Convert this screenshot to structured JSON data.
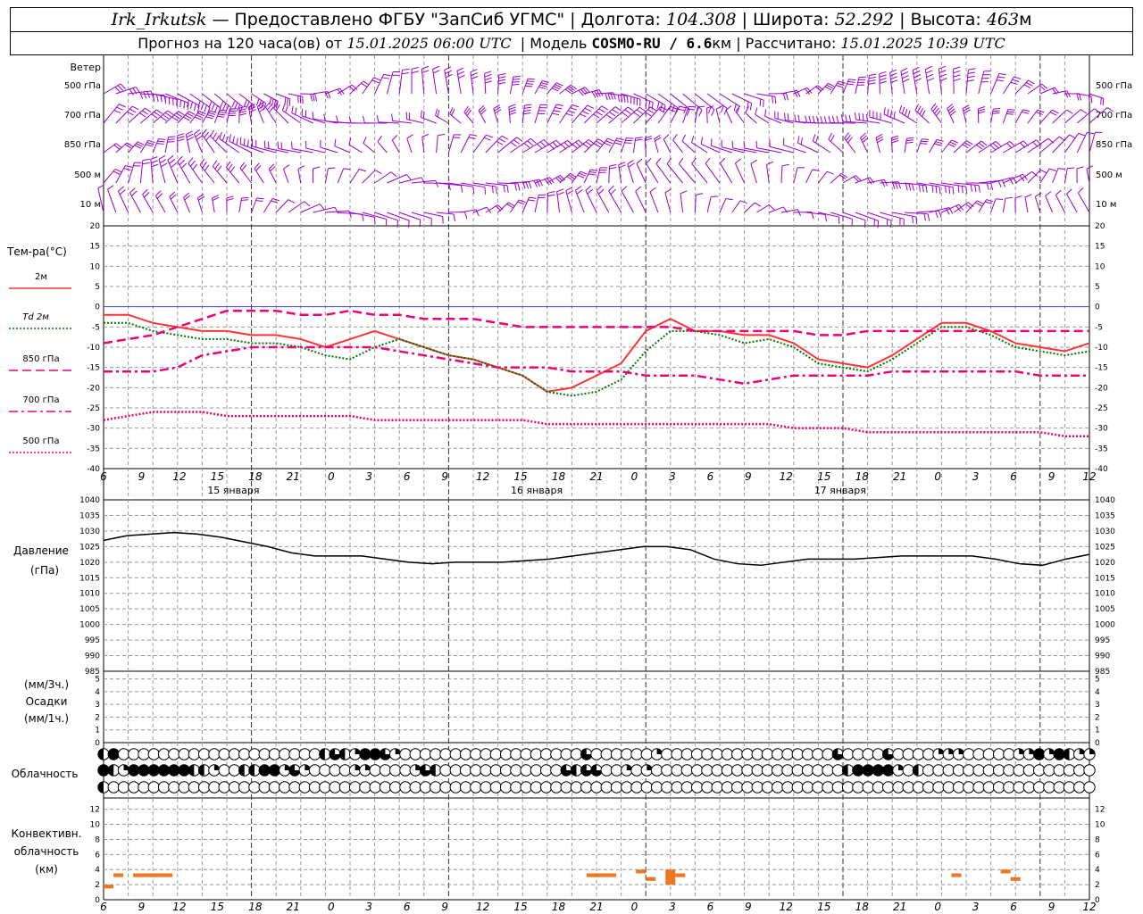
{
  "header": {
    "station": "Irk_Irkutsk",
    "provider": "— Предоставлено ФГБУ \"ЗапСиб УГМС\"",
    "lon_label": "Долгота:",
    "lon_value": "104.308",
    "lat_label": "Широта:",
    "lat_value": "52.292",
    "alt_label": "Высота:",
    "alt_value": "463",
    "alt_unit": "м",
    "forecast_label": "Прогноз на 120 часа(ов) от",
    "forecast_start": "15.01.2025 06:00 UTC",
    "model_label": "Модель",
    "model_name": "COSMO-RU / 6.6",
    "model_unit": "км",
    "calc_label": "Рассчитано:",
    "calc_time": "15.01.2025 10:39 UTC"
  },
  "wind_panel": {
    "title": "Ветер",
    "levels": [
      "500 гПа",
      "700 гПа",
      "850 гПа",
      "500 м",
      "10 м"
    ],
    "color": "#9900cc"
  },
  "x_axis": {
    "hour_ticks": [
      "6",
      "9",
      "12",
      "15",
      "18",
      "21",
      "0",
      "3",
      "6",
      "9",
      "12",
      "15",
      "18",
      "21",
      "0",
      "3",
      "6",
      "9",
      "12",
      "15",
      "18",
      "21",
      "0",
      "3",
      "6",
      "9",
      "12"
    ],
    "day_labels": [
      "15 января",
      "16 января",
      "17 января"
    ]
  },
  "temp_panel": {
    "title": "Тем-ра(°С)",
    "legend": [
      {
        "label": "2м",
        "color": "#ff3333",
        "style": "solid"
      },
      {
        "label": "Td 2м",
        "color": "#007700",
        "style": "dotted"
      },
      {
        "label": "850 гПа",
        "color": "#ee0077",
        "style": "dashed"
      },
      {
        "label": "700 гПа",
        "color": "#ee0077",
        "style": "dashdot"
      },
      {
        "label": "500 гПа",
        "color": "#ee0077",
        "style": "dotted"
      }
    ],
    "y_ticks": [
      "20",
      "15",
      "10",
      "5",
      "0",
      "-5",
      "-10",
      "-15",
      "-20",
      "-25",
      "-30",
      "-35",
      "-40"
    ]
  },
  "pressure_panel": {
    "title": "Давление",
    "unit": "(гПа)",
    "y_ticks": [
      "1040",
      "1035",
      "1030",
      "1025",
      "1020",
      "1015",
      "1010",
      "1005",
      "1000",
      "995",
      "990",
      "985"
    ]
  },
  "precip_panel": {
    "unit3": "(мм/3ч.)",
    "title": "Осадки",
    "unit1": "(мм/1ч.)",
    "y_ticks": [
      "5",
      "4",
      "3",
      "2",
      "1",
      "0"
    ]
  },
  "cloud_panel": {
    "title": "Облачность"
  },
  "conv_panel": {
    "title1": "Конвективн.",
    "title2": "облачность",
    "unit": "(км)",
    "y_ticks": [
      "12",
      "10",
      "8",
      "6",
      "4",
      "2",
      "0"
    ]
  },
  "chart_data": [
    {
      "type": "line",
      "id": "temperature",
      "x_hours": [
        0,
        3,
        6,
        9,
        12,
        15,
        18,
        21,
        24,
        27,
        30,
        33,
        36,
        39,
        42,
        45,
        48,
        51,
        54,
        57,
        60,
        63,
        66,
        69,
        72,
        75,
        78,
        81,
        84,
        87,
        90,
        93,
        96,
        99,
        102,
        105,
        108,
        111,
        114,
        117,
        120
      ],
      "ylim": [
        -40,
        20
      ],
      "series": [
        {
          "name": "2м",
          "values": [
            -2,
            -2,
            -4,
            -5,
            -6,
            -6,
            -7,
            -7,
            -8,
            -10,
            -8,
            -6,
            -8,
            -10,
            -12,
            -13,
            -15,
            -17,
            -21,
            -20,
            -17,
            -14,
            -6,
            -3,
            -6,
            -6,
            -7,
            -7,
            -9,
            -13,
            -14,
            -15,
            -12,
            -8,
            -4,
            -4,
            -6,
            -9,
            -10,
            -11,
            -9
          ]
        },
        {
          "name": "Td 2м",
          "values": [
            -4,
            -4,
            -6,
            -7,
            -8,
            -8,
            -9,
            -9,
            -10,
            -12,
            -13,
            -10,
            -8,
            -10,
            -12,
            -13,
            -15,
            -17,
            -21,
            -22,
            -21,
            -18,
            -11,
            -6,
            -6,
            -7,
            -9,
            -8,
            -10,
            -14,
            -15,
            -16,
            -13,
            -9,
            -5,
            -5,
            -7,
            -10,
            -11,
            -12,
            -11
          ]
        },
        {
          "name": "850 гПа",
          "values": [
            -9,
            -8,
            -7,
            -5,
            -3,
            -1,
            -1,
            -1,
            -2,
            -2,
            -1,
            -2,
            -2,
            -3,
            -3,
            -3,
            -4,
            -5,
            -5,
            -5,
            -5,
            -5,
            -5,
            -5,
            -6,
            -6,
            -6,
            -6,
            -6,
            -7,
            -7,
            -6,
            -6,
            -6,
            -6,
            -6,
            -6,
            -6,
            -6,
            -6,
            -6
          ]
        },
        {
          "name": "700 гПа",
          "values": [
            -16,
            -16,
            -16,
            -15,
            -12,
            -11,
            -10,
            -10,
            -10,
            -10,
            -10,
            -10,
            -11,
            -12,
            -13,
            -14,
            -15,
            -15,
            -15,
            -16,
            -16,
            -16,
            -17,
            -17,
            -17,
            -18,
            -19,
            -18,
            -17,
            -17,
            -17,
            -17,
            -16,
            -16,
            -16,
            -16,
            -16,
            -16,
            -17,
            -17,
            -17
          ]
        },
        {
          "name": "500 гПа",
          "values": [
            -28,
            -27,
            -26,
            -26,
            -26,
            -27,
            -27,
            -27,
            -27,
            -27,
            -27,
            -28,
            -28,
            -28,
            -28,
            -28,
            -28,
            -28,
            -29,
            -29,
            -29,
            -29,
            -29,
            -29,
            -29,
            -29,
            -29,
            -29,
            -30,
            -30,
            -30,
            -31,
            -31,
            -31,
            -31,
            -31,
            -31,
            -31,
            -31,
            -32,
            -32
          ]
        }
      ]
    },
    {
      "type": "line",
      "id": "pressure",
      "x_hours": [
        0,
        3,
        6,
        9,
        12,
        15,
        18,
        21,
        24,
        27,
        30,
        33,
        36,
        39,
        42,
        45,
        48,
        51,
        54,
        57,
        60,
        63,
        66,
        69,
        72,
        75,
        78,
        81,
        84,
        87,
        90,
        93,
        96,
        99,
        102,
        105,
        108,
        111,
        114,
        117,
        120
      ],
      "ylim": [
        985,
        1040
      ],
      "series": [
        {
          "name": "Давление",
          "values": [
            1027,
            1028.5,
            1029,
            1029.5,
            1029,
            1028,
            1026.5,
            1025,
            1023,
            1022,
            1022,
            1022,
            1021,
            1020,
            1019.5,
            1020,
            1020,
            1020,
            1020.5,
            1021,
            1022,
            1023,
            1024,
            1025,
            1025,
            1024,
            1021,
            1019.5,
            1019,
            1020,
            1021,
            1021,
            1021,
            1021.5,
            1022,
            1022,
            1022,
            1022,
            1021,
            1019.5,
            1019,
            1021,
            1022.5
          ]
        }
      ]
    },
    {
      "type": "bar",
      "id": "precipitation",
      "ylim": [
        0,
        5
      ],
      "values": []
    },
    {
      "type": "bar",
      "id": "convective_cloud",
      "ylim": [
        0,
        12
      ],
      "unit": "км",
      "segments": [
        {
          "x0": 0,
          "x1": 1,
          "base": 1.5,
          "top": 2
        },
        {
          "x0": 1,
          "x1": 2,
          "base": 3,
          "top": 3.5
        },
        {
          "x0": 3,
          "x1": 7,
          "base": 3,
          "top": 3.5
        },
        {
          "x0": 49,
          "x1": 52,
          "base": 3,
          "top": 3.5
        },
        {
          "x0": 54,
          "x1": 55,
          "base": 3.5,
          "top": 4
        },
        {
          "x0": 55,
          "x1": 56,
          "base": 2.5,
          "top": 3
        },
        {
          "x0": 57,
          "x1": 58,
          "base": 2,
          "top": 4
        },
        {
          "x0": 58,
          "x1": 59,
          "base": 3,
          "top": 3.5
        },
        {
          "x0": 86,
          "x1": 87,
          "base": 3,
          "top": 3.5
        },
        {
          "x0": 91,
          "x1": 92,
          "base": 3.5,
          "top": 4
        },
        {
          "x0": 92,
          "x1": 93,
          "base": 2.5,
          "top": 3
        }
      ]
    }
  ],
  "cloud_rows": [
    "HFLLLLLLLLLLLLLLLLLLLLHTHQFFTQLLLLLLLLLLLLLLLLLLTLLLLLLQLLLLLLLLLLLLLLLLLTLLLLTLLLLQQQLLLLLQQFQFHQQLLLQHLLLLLLLLLLLLLLLQHTLLLLLLLLLLLQFLLLLLLLLLLLLLLLLLLLLLLLLLLLLLLLLLLLLLLLLLLLHFHHFHHTHQHTHTLLLLLLLLLLLLLLLLLLLLLLLL",
    "FHQFFFFFFHHQLLHHFFQTQLLLLQQLLLLQTHLLLLLLLLLLLLTHTTLLQLQLLLLLLLLLLLLLLLLLLLHFFFFQLHLLLLLLLLLLLLLLLLLLLLLLLLLLLLLLLLLLLLQFFFFHQFFFFFFFQFHHFQFTLLLLLLLLLLLLLLLLLLLLLLLLLLLLLLLLLLLLLLLLLLLHTQLQLQHQLLLLLLLLLLLLLLHFFHFFTLLLL",
    "HLLLLLLLLLLLLLLLLLLLLLLLLLLLLLLLLLLLLLLLLLLLLLLLLLLLLLLLLLLLLLLLLLLLLLLLLLLLLLLLLLLLLLLLLLLLLLLLLLLLLLLLLLLLLLLLLLLLLLLLLLLLLLLLLLLLLLLLLLLLLLLLLLLLLLLLLLLLLLLLLLLLLLLLLLLLLLLLLLLLLLLLLLLLLLLLLLLLLLLLLLLLLLLLLLLLLLLLLLLLLLLLLLLLLLLLLLL"
  ],
  "colors": {
    "wind": "#9900cc",
    "pressure": "#000000",
    "conv": "#ee7722",
    "grid": "#999999",
    "zero_line": "#3344dd"
  }
}
